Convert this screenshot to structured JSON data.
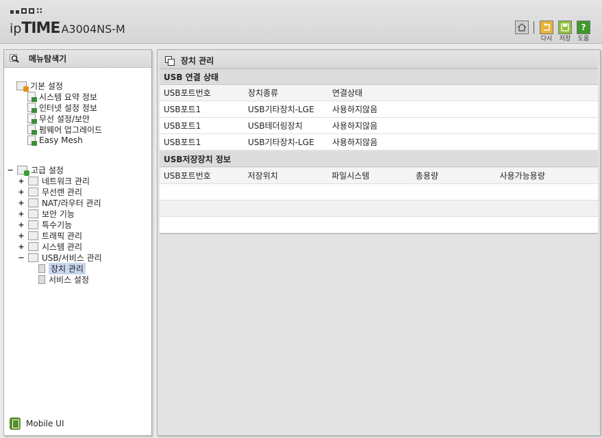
{
  "header": {
    "brand_ip": "ip",
    "brand_time": "TIME",
    "model": "A3004NS-M",
    "buttons": [
      {
        "id": "home",
        "label": "",
        "icon": "home-icon"
      },
      {
        "id": "undo",
        "label": "다시",
        "icon": "undo-icon"
      },
      {
        "id": "save",
        "label": "저장",
        "icon": "save-icon"
      },
      {
        "id": "help",
        "label": "도움",
        "icon": "help-icon"
      }
    ]
  },
  "sidebar": {
    "title": "메뉴탐색기",
    "basic": {
      "label": "기본 설정",
      "items": [
        "시스템 요약 정보",
        "인터넷 설정 정보",
        "무선 설정/보안",
        "펌웨어 업그레이드",
        "Easy Mesh"
      ]
    },
    "advanced": {
      "toggle": "−",
      "label": "고급 설정",
      "items": [
        {
          "toggle": "+",
          "label": "네트워크 관리"
        },
        {
          "toggle": "+",
          "label": "무선랜 관리"
        },
        {
          "toggle": "+",
          "label": "NAT/라우터 관리"
        },
        {
          "toggle": "+",
          "label": "보안 기능"
        },
        {
          "toggle": "+",
          "label": "특수기능"
        },
        {
          "toggle": "+",
          "label": "트래픽 관리"
        },
        {
          "toggle": "+",
          "label": "시스템 관리"
        },
        {
          "toggle": "−",
          "label": "USB/서비스 관리"
        }
      ],
      "usb_children": [
        "장치 관리",
        "서비스 설정"
      ]
    },
    "mobile_label": "Mobile UI"
  },
  "main": {
    "title": "장치 관리",
    "usb_status": {
      "title": "USB 연결 상태",
      "columns": [
        "USB포트번호",
        "장치종류",
        "연결상태"
      ],
      "rows": [
        [
          "USB포트1",
          "USB기타장치-LGE",
          "사용하지않음"
        ],
        [
          "USB포트1",
          "USB테더링장치",
          "사용하지않음"
        ],
        [
          "USB포트1",
          "USB기타장치-LGE",
          "사용하지않음"
        ]
      ]
    },
    "storage": {
      "title": "USB저장장치 정보",
      "columns": [
        "USB포트번호",
        "저장위치",
        "파일시스템",
        "총용량",
        "사용가능용량"
      ]
    }
  },
  "colors": {
    "selected": "#c8d6ef",
    "undo": "#e8b33a",
    "save": "#8fc13b",
    "help": "#3f9a2a"
  }
}
